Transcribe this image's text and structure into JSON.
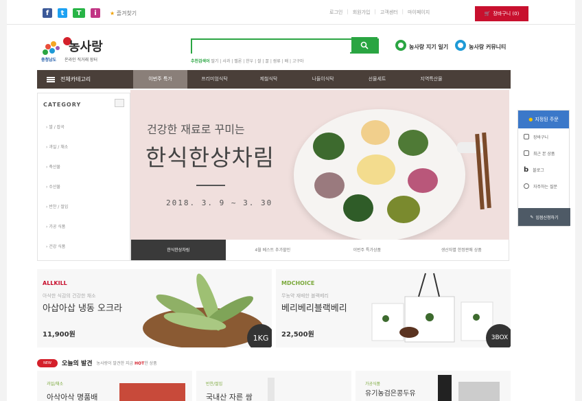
{
  "topbar": {
    "social_icons": [
      {
        "icon": "facebook-icon",
        "glyph": "f",
        "color": "#3b5998"
      },
      {
        "icon": "twitter-icon",
        "glyph": "t",
        "color": "#1da1f2"
      },
      {
        "icon": "kakao-talk-icon",
        "glyph": "T",
        "color": "#28b446"
      },
      {
        "icon": "instagram-icon",
        "glyph": "i",
        "color": "#c13584"
      }
    ],
    "favorite_label": "즐겨찾기",
    "links": [
      "로그인",
      "회원가입",
      "고객센터",
      "마이페이지"
    ],
    "cart_label": "장바구니 (0)"
  },
  "logo": {
    "brand": "농사랑",
    "tagline": "온라인 직거래 장터",
    "org": "충청남도"
  },
  "search": {
    "placeholder": "",
    "hot_label": "추천검색어",
    "hot_keywords": "딸기 | 사과 | 멜론 | 한우 | 쌀 | 꿀 | 쌈류 | 배 | 고구마"
  },
  "right_links": [
    {
      "label": "농사랑 지기 일기",
      "icon": "map-pin-icon"
    },
    {
      "label": "농사랑 커뮤니티",
      "icon": "comment-icon"
    }
  ],
  "nav": {
    "all_label": "전체카테고리",
    "items": [
      "이번주 특가",
      "프리미엄식탁",
      "제철식탁",
      "나들이식탁",
      "선물세트",
      "지역특산물"
    ],
    "active_index": 0
  },
  "category": {
    "title": "CATEGORY",
    "items": [
      "쌀 / 잡곡",
      "과일 / 채소",
      "축산물",
      "수산물",
      "반찬 / 절임",
      "가공 식품",
      "건강 식품"
    ]
  },
  "banner": {
    "subtitle": "건강한 재료로 꾸미는",
    "title": "한식한상차림",
    "date": "2018. 3. 9 ~ 3. 30",
    "tabs": [
      "한식한상차림",
      "4월 베스트 추가할인",
      "이번주 특가상품",
      "생산자별 한정판매 상품"
    ],
    "active_tab": 0
  },
  "quick_menu": {
    "top": "지정된 주문",
    "items": [
      {
        "label": "장바구니",
        "icon": "cart-icon"
      },
      {
        "label": "최근 본 상품",
        "icon": "document-icon"
      },
      {
        "label": "블로그",
        "icon": "blog-icon"
      },
      {
        "label": "자주하는 질문",
        "icon": "eye-icon"
      }
    ],
    "bottom": "입점신청하기"
  },
  "products": [
    {
      "brand": "ALLKILL",
      "sub": "아삭한 식감의 건강한 채소",
      "name": "아삽아삽 냉동 오크라",
      "price": "11,900원",
      "badge": "1KG",
      "brand_color": "#c8102e"
    },
    {
      "brand": "MDCHOICE",
      "sub": "무농약 재배한 블랙베리",
      "name": "베리베리블랙베리",
      "price": "22,500원",
      "badge": "3BOX",
      "brand_color": "#7aa83a"
    }
  ],
  "today": {
    "pill": "NEW",
    "title": "오늘의 발견",
    "subtitle_pre": "농사랑이 발견한 지금",
    "subtitle_hot": "HOT",
    "subtitle_post": "한 상품"
  },
  "cards": [
    {
      "category": "과일/채소",
      "name": "아삭아삭 명품배"
    },
    {
      "category": "반찬/절임",
      "name": "국내산 자른 쌈"
    },
    {
      "category": "가공식품",
      "name": "유기농검은콩두유"
    }
  ]
}
